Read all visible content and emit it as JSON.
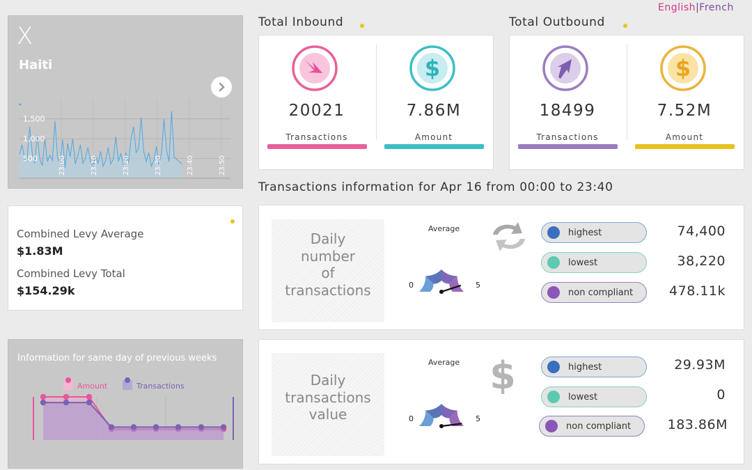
{
  "language": {
    "english": "English",
    "separator": "|",
    "french": "French"
  },
  "map_card": {
    "mark": "X",
    "country": "Haiti",
    "next_icon": "chevron-right-icon"
  },
  "mini_chart": {
    "y_ticks": [
      "1,500",
      "1,000",
      "500"
    ],
    "x_ticks": [
      "23:00",
      "23:10",
      "23:20",
      "23:30",
      "23:40",
      "23:50"
    ],
    "values": [
      600,
      850,
      500,
      450,
      1300,
      650,
      380,
      1100,
      480,
      320,
      1000,
      420,
      580,
      450,
      1450,
      520,
      380,
      980,
      260,
      880,
      540,
      1000,
      360,
      560,
      850,
      380,
      500,
      780,
      420,
      300,
      560,
      380,
      680,
      300,
      450,
      780,
      360,
      480,
      1050,
      420,
      620,
      340,
      650,
      380,
      980,
      1300,
      650,
      760,
      1530,
      680,
      420,
      650,
      300,
      450,
      800,
      350,
      620,
      1500,
      700,
      420,
      1700,
      520,
      480,
      420,
      360
    ]
  },
  "levy": {
    "average_label": "Combined Levy Average",
    "average_value": "$1.83M",
    "total_label": "Combined Levy Total",
    "total_value": "$154.29k"
  },
  "previous_weeks": {
    "title": "Information for same day of previous weeks",
    "legend_amount": "Amount",
    "legend_transactions": "Transactions",
    "amount_values": [
      1.0,
      1.0,
      1.0,
      0.25,
      0.25,
      0.25,
      0.25,
      0.25,
      0.25
    ],
    "transaction_values": [
      0.87,
      0.87,
      0.87,
      0.3,
      0.3,
      0.3,
      0.3,
      0.3,
      0.3
    ],
    "colors": {
      "amount": "#e8569e",
      "transactions": "#7a62b3"
    }
  },
  "inbound": {
    "title": "Total Inbound",
    "transactions_value": "20021",
    "transactions_label": "Transactions",
    "amount_value": "7.86M",
    "amount_label": "Amount",
    "transactions_icon": "arrow-down-right-icon",
    "amount_icon": "dollar-icon",
    "colors": {
      "transactions": "#e8609a",
      "amount": "#3bbfc6"
    }
  },
  "outbound": {
    "title": "Total Outbound",
    "transactions_value": "18499",
    "transactions_label": "Transactions",
    "amount_value": "7.52M",
    "amount_label": "Amount",
    "transactions_icon": "arrow-up-right-icon",
    "amount_icon": "dollar-icon",
    "colors": {
      "transactions": "#9b7cc0",
      "amount": "#e8c21e"
    }
  },
  "info_title": "Transactions information for Apr 16 from 00:00 to 23:40",
  "daily_count": {
    "label": "Daily number of transactions",
    "average_label": "Average",
    "gauge_min": "0",
    "gauge_max": "5",
    "gauge_value": 4.4,
    "icon": "exchange-arrows-icon",
    "highest_label": "highest",
    "highest_value": "74,400",
    "lowest_label": "lowest",
    "lowest_value": "38,220",
    "noncompliant_label": "non compliant",
    "noncompliant_value": "478.11k"
  },
  "daily_value": {
    "label": "Daily transactions value",
    "average_label": "Average",
    "gauge_min": "0",
    "gauge_max": "5",
    "gauge_value": 4.7,
    "icon": "dollar-sign-icon",
    "highest_label": "highest",
    "highest_value": "29.93M",
    "lowest_label": "lowest",
    "lowest_value": "0",
    "noncompliant_label": "non compliant",
    "noncompliant_value": "183.86M"
  },
  "pill_colors": {
    "highest": "#3a6fbf",
    "lowest": "#5ccaae",
    "noncompliant": "#8a56b8"
  }
}
